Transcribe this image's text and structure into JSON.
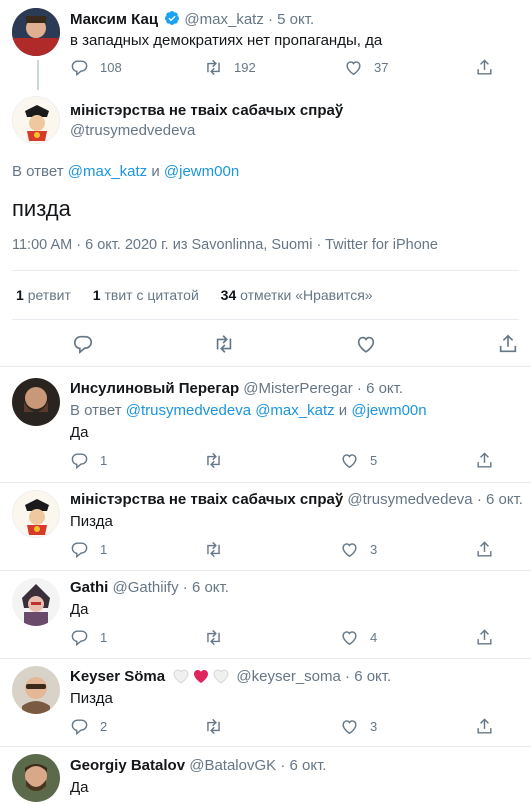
{
  "parent_tweet": {
    "name": "Максим Кац",
    "handle": "@max_katz",
    "time": "5 окт.",
    "text": "в западных демократиях нет пропаганды, да",
    "replies": "108",
    "retweets": "192",
    "likes": "37"
  },
  "main_tweet": {
    "name": "міністэрства не тваіх сабачых спраў",
    "handle": "@trusymedvedeva",
    "reply_prefix": "В ответ",
    "reply_to_1": "@max_katz",
    "reply_and": "и",
    "reply_to_2": "@jewm00n",
    "text": "пизда",
    "meta_time": "11:00 AM",
    "meta_sep1": "·",
    "meta_date": "6 окт. 2020 г.",
    "meta_from": "из",
    "meta_place": "Savonlinna, Suomi",
    "meta_sep2": "·",
    "meta_client": "Twitter for iPhone",
    "stats": {
      "retweets_count": "1",
      "retweets_label": "ретвит",
      "quotes_count": "1",
      "quotes_label": "твит с цитатой",
      "likes_count": "34",
      "likes_label": "отметки «Нравится»"
    }
  },
  "replies": [
    {
      "name": "Инсулиновый Перегар",
      "handle": "@MisterPeregar",
      "time": "6 окт.",
      "reply_prefix": "В ответ",
      "reply_to_1": "@trusymedvedeva",
      "reply_to_2": "@max_katz",
      "reply_and": "и",
      "reply_to_3": "@jewm00n",
      "text": "Да",
      "replies": "1",
      "retweets": "",
      "likes": "5"
    },
    {
      "name": "міністэрства не тваіх сабачых спраў",
      "handle": "@trusymedvedeva",
      "time": "6 окт.",
      "text": "Пизда",
      "replies": "1",
      "retweets": "",
      "likes": "3"
    },
    {
      "name": "Gathi",
      "handle": "@Gathiify",
      "time": "6 окт.",
      "text": "Да",
      "replies": "1",
      "retweets": "",
      "likes": "4"
    },
    {
      "name": "Keyser Söma",
      "handle": "@keyser_soma",
      "time": "6 окт.",
      "text": "Пизда",
      "replies": "2",
      "retweets": "",
      "likes": "3"
    },
    {
      "name": "Georgiy Batalov",
      "handle": "@BatalovGK",
      "time": "6 окт.",
      "text": "Да"
    }
  ],
  "dot": "·",
  "colors": {
    "accent": "#1b95e0",
    "secondary_text": "#657786",
    "border": "#e6ecf0",
    "heart_red": "#e0245e"
  },
  "icons": [
    "reply-icon",
    "retweet-icon",
    "like-icon",
    "share-icon",
    "verified-badge-icon"
  ]
}
